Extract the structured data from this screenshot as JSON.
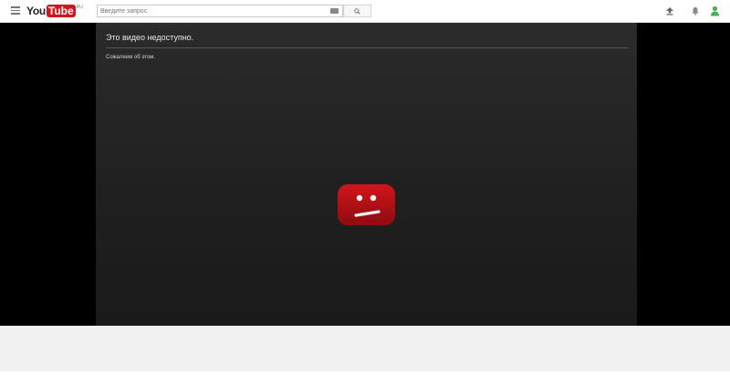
{
  "masthead": {
    "logo": {
      "you": "You",
      "tube": "Tube",
      "country": "RU"
    },
    "search": {
      "placeholder": "Введите запрос"
    },
    "icons": {
      "guide": "hamburger-icon",
      "keyboard": "keyboard-icon",
      "search": "search-icon",
      "upload": "upload-icon",
      "notifications": "bell-icon",
      "account": "avatar-icon"
    }
  },
  "player": {
    "error_title": "Это видео недоступно.",
    "error_subtitle": "Сожалеем об этом.",
    "icon": "sad-face-icon"
  },
  "colors": {
    "brand_red": "#cc181e",
    "avatar_green": "#4caf50"
  }
}
